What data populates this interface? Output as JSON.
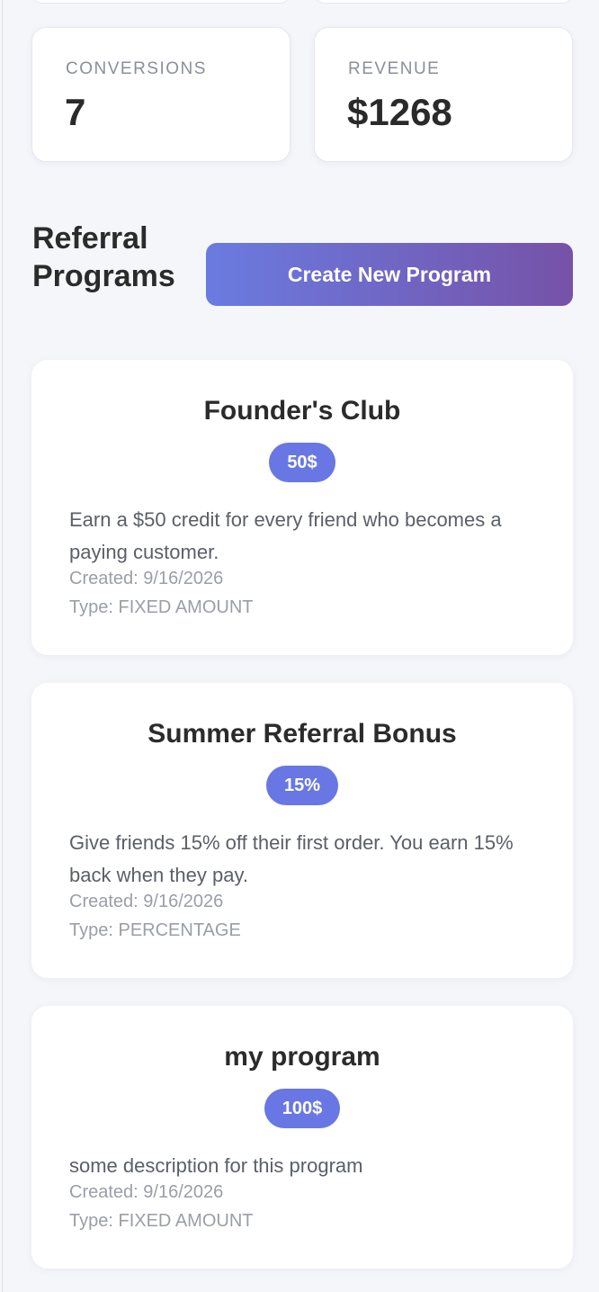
{
  "stats": [
    {
      "label": "CONVERSIONS",
      "value": "7"
    },
    {
      "label": "REVENUE",
      "value": "$1268"
    }
  ],
  "section": {
    "title": "Referral Programs",
    "create_button_label": "Create New Program"
  },
  "programs": [
    {
      "name": "Founder's Club",
      "badge": "50$",
      "description": "Earn a $50 credit for every friend who becomes a paying customer.",
      "created": "Created: 9/16/2026",
      "type": "Type: FIXED AMOUNT"
    },
    {
      "name": "Summer Referral Bonus",
      "badge": "15%",
      "description": "Give friends 15% off their first order. You earn 15% back when they pay.",
      "created": "Created: 9/16/2026",
      "type": "Type: PERCENTAGE"
    },
    {
      "name": "my program",
      "badge": "100$",
      "description": "some description for this program",
      "created": "Created: 9/16/2026",
      "type": "Type: FIXED AMOUNT"
    }
  ],
  "colors": {
    "accent": "#6877e3",
    "button_gradient_start": "#6a7be0",
    "button_gradient_end": "#7652a8",
    "background": "#f5f6fa"
  }
}
